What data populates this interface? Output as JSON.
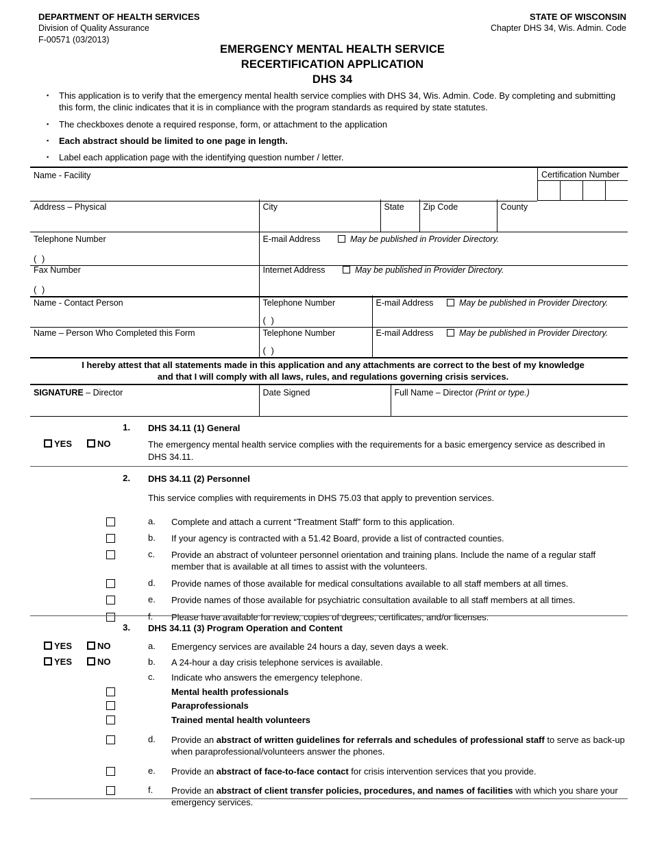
{
  "header": {
    "dept": "DEPARTMENT OF HEALTH SERVICES",
    "division": "Division of Quality Assurance",
    "form_number": "F-00571 (03/2013)",
    "state": "STATE OF WISCONSIN",
    "chapter": "Chapter DHS 34, Wis. Admin. Code"
  },
  "title": {
    "line1": "EMERGENCY MENTAL HEALTH SERVICE",
    "line2": "RECERTIFICATION APPLICATION",
    "line3": "DHS 34"
  },
  "bullets": [
    {
      "text": "This application is to verify that the emergency mental health service complies with DHS 34, Wis. Admin. Code.   By completing and submitting this form, the clinic indicates that it is in compliance with the program standards as required by state statutes.",
      "bold": false
    },
    {
      "text": "The checkboxes denote a required response, form, or attachment to the application",
      "bold": false
    },
    {
      "text": "Each abstract should be limited to one page in length.",
      "bold": true
    },
    {
      "text": "Label each application page with the identifying question number / letter.",
      "bold": false
    }
  ],
  "facility": {
    "name_facility": "Name - Facility",
    "certification_number": "Certification Number",
    "address_physical": "Address – Physical",
    "city": "City",
    "state": "State",
    "zip_code": "Zip Code",
    "county": "County",
    "telephone_number": "Telephone Number",
    "email_address": "E-mail Address",
    "fax_number": "Fax Number",
    "internet_address": "Internet Address",
    "may_be_published": "May be published in Provider Directory.",
    "phone_paren": "(          )"
  },
  "contacts": {
    "name_contact_person": "Name - Contact Person",
    "name_person_completed": "Name – Person Who Completed this Form",
    "telephone_number": "Telephone Number",
    "email_address": "E-mail Address",
    "may_be_published": "May be published in Provider Directory.",
    "phone_paren": "(          )"
  },
  "attestation": {
    "line1": "I hereby attest that all statements made in this application and any attachments are correct to the best of my knowledge",
    "line2": "and that I will comply with all laws, rules, and regulations governing crisis services."
  },
  "signature": {
    "signature_label_bold": "SIGNATURE",
    "signature_label_rest": " – Director",
    "date_signed": "Date Signed",
    "full_name_bold": "Full Name – Director ",
    "full_name_italic": "(Print or type.)"
  },
  "labels": {
    "yes": "YES",
    "no": "NO"
  },
  "sections": [
    {
      "number": "1.",
      "title": "DHS 34.11 (1)  General",
      "items": [
        {
          "control": "yesno",
          "letter": "",
          "text": "The emergency mental health service complies with the requirements for a basic emergency service as described in DHS 34.11."
        }
      ]
    },
    {
      "number": "2.",
      "title": "DHS 34.11 (2)  Personnel",
      "intro": "This service complies with requirements in DHS 75.03 that apply to prevention services.",
      "items": [
        {
          "control": "checkbox",
          "letter": "a.",
          "text": "Complete and attach a current “Treatment Staff” form to this application."
        },
        {
          "control": "checkbox",
          "letter": "b.",
          "text": "If your agency is contracted with a 51.42 Board, provide a list of contracted counties."
        },
        {
          "control": "checkbox",
          "letter": "c.",
          "text": "Provide an abstract of volunteer personnel orientation and training plans.  Include the name of a regular staff member that is available at all times to assist with the volunteers."
        },
        {
          "control": "checkbox",
          "letter": "d.",
          "text": "Provide names of those available for medical consultations available to all staff members at all times."
        },
        {
          "control": "checkbox",
          "letter": "e.",
          "text": "Provide names of those available for psychiatric consultation available to all staff members at all times."
        },
        {
          "control": "checkbox",
          "letter": "f.",
          "text": "Please have available for review, copies of degrees, certificates, and/or licenses."
        }
      ]
    },
    {
      "number": "3.",
      "title": "DHS 34.11 (3)  Program Operation and Content",
      "items": [
        {
          "control": "yesno",
          "letter": "a.",
          "text": "Emergency services are available 24 hours a day, seven days a week."
        },
        {
          "control": "yesno",
          "letter": "b.",
          "text": "A 24-hour a day crisis telephone services is available."
        },
        {
          "control": "none",
          "letter": "c.",
          "text": "Indicate who answers the emergency telephone."
        },
        {
          "control": "checkbox",
          "letter": "",
          "text": "Mental health professionals",
          "bold": true
        },
        {
          "control": "checkbox",
          "letter": "",
          "text": "Paraprofessionals",
          "bold": true
        },
        {
          "control": "checkbox",
          "letter": "",
          "text": "Trained mental health volunteers",
          "bold": true
        },
        {
          "control": "checkbox",
          "letter": "d.",
          "text_parts": [
            {
              "t": "Provide an ",
              "b": false
            },
            {
              "t": "abstract of written guidelines for referrals and schedules of professional staff",
              "b": true
            },
            {
              "t": " to serve as back-up when paraprofessional/volunteers answer the phones.",
              "b": false
            }
          ]
        },
        {
          "control": "checkbox",
          "letter": "e.",
          "text_parts": [
            {
              "t": "Provide an ",
              "b": false
            },
            {
              "t": "abstract of face-to-face contact",
              "b": true
            },
            {
              "t": " for crisis intervention services that you provide.",
              "b": false
            }
          ]
        },
        {
          "control": "checkbox",
          "letter": "f.",
          "text_parts": [
            {
              "t": "Provide an ",
              "b": false
            },
            {
              "t": "abstract of client transfer policies, procedures, and names of facilities",
              "b": true
            },
            {
              "t": " with which you share your emergency services.",
              "b": false
            }
          ]
        }
      ]
    }
  ]
}
